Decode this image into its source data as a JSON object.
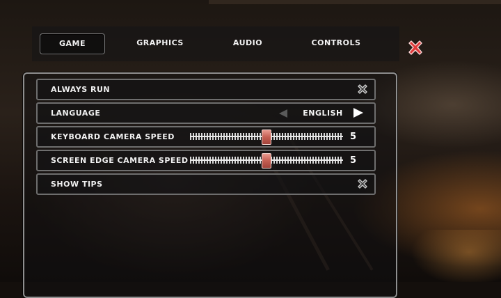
{
  "tabs": [
    {
      "label": "GAME",
      "active": true
    },
    {
      "label": "GRAPHICS",
      "active": false
    },
    {
      "label": "AUDIO",
      "active": false
    },
    {
      "label": "CONTROLS",
      "active": false
    }
  ],
  "close_icon": "close-x-icon",
  "settings": {
    "always_run": {
      "label": "ALWAYS RUN",
      "checked": false
    },
    "language": {
      "label": "LANGUAGE",
      "value": "ENGLISH"
    },
    "keyboard_camera_speed": {
      "label": "KEYBOARD CAMERA SPEED",
      "value": "5",
      "min": 0,
      "max": 10,
      "level": 0.5
    },
    "screen_edge_camera_speed": {
      "label": "SCREEN EDGE CAMERA SPEED",
      "value": "5",
      "min": 0,
      "max": 10,
      "level": 0.5
    },
    "show_tips": {
      "label": "SHOW TIPS",
      "checked": false
    }
  },
  "colors": {
    "close_red": "#e03a3a",
    "slider_handle": "#c45e52",
    "text": "#f0f0f0"
  }
}
